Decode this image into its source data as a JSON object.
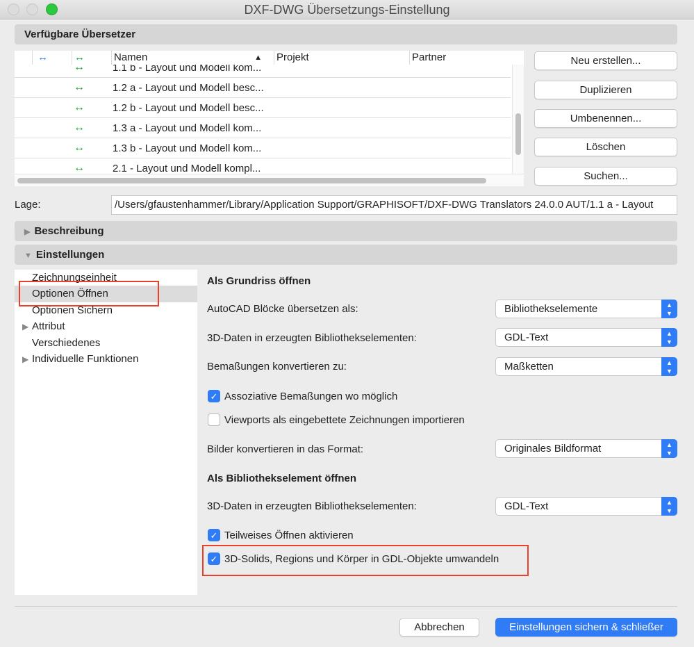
{
  "window": {
    "title": "DXF-DWG Übersetzungs-Einstellung"
  },
  "translators": {
    "header": "Verfügbare Übersetzer",
    "columns": {
      "name": "Namen",
      "project": "Projekt",
      "partner": "Partner"
    },
    "rows": [
      {
        "name": "1.1 b - Layout und Modell kom..."
      },
      {
        "name": "1.2 a - Layout und Modell besc..."
      },
      {
        "name": "1.2 b - Layout und Modell besc..."
      },
      {
        "name": "1.3 a - Layout und Modell kom..."
      },
      {
        "name": "1.3 b - Layout und Modell kom..."
      },
      {
        "name": "2.1 - Layout und Modell kompl..."
      }
    ],
    "buttons": {
      "new": "Neu erstellen...",
      "duplicate": "Duplizieren",
      "rename": "Umbenennen...",
      "delete": "Löschen",
      "search": "Suchen..."
    }
  },
  "location": {
    "label": "Lage:",
    "value": "/Users/gfaustenhammer/Library/Application Support/GRAPHISOFT/DXF-DWG Translators 24.0.0 AUT/1.1 a - Layout"
  },
  "sections": {
    "description": "Beschreibung",
    "settings": "Einstellungen"
  },
  "tree": [
    "Zeichnungseinheit",
    "Optionen Öffnen",
    "Optionen Sichern",
    "Attribut",
    "Verschiedenes",
    "Individuelle Funktionen"
  ],
  "options": {
    "floorplan_header": "Als Grundriss öffnen",
    "blocks_label": "AutoCAD Blöcke übersetzen als:",
    "blocks_value": "Bibliothekselemente",
    "data3d_label": "3D-Daten in erzeugten Bibliothekselementen:",
    "data3d_value": "GDL-Text",
    "dims_label": "Bemaßungen konvertieren zu:",
    "dims_value": "Maßketten",
    "assoc_dims": "Assoziative Bemaßungen wo möglich",
    "assoc_checked": true,
    "viewports": "Viewports als eingebettete Zeichnungen importieren",
    "viewports_checked": false,
    "images_label": "Bilder konvertieren in das Format:",
    "images_value": "Originales Bildformat",
    "library_header": "Als Bibliothekselement öffnen",
    "lib_data3d_label": "3D-Daten in erzeugten Bibliothekselementen:",
    "lib_data3d_value": "GDL-Text",
    "partial_open": "Teilweises Öffnen aktivieren",
    "partial_checked": true,
    "solids": "3D-Solids, Regions und Körper in GDL-Objekte umwandeln",
    "solids_checked": true
  },
  "footer": {
    "cancel": "Abbrechen",
    "save": "Einstellungen sichern & schließer"
  },
  "colors": {
    "accent": "#2f7cf6",
    "highlight": "#e8402a",
    "green_arrow": "#1aa33a"
  }
}
